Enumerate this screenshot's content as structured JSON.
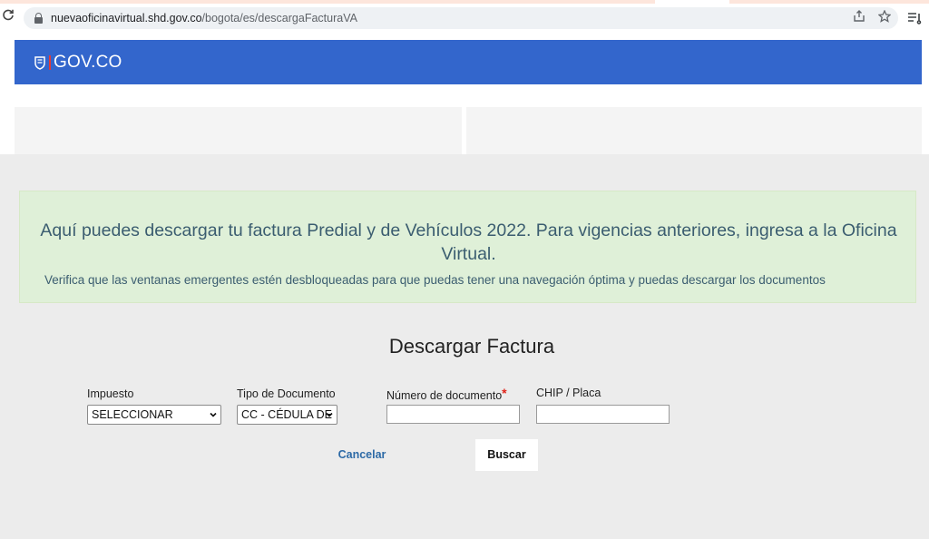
{
  "browser": {
    "url_domain": "nuevaoficinavirtual.shd.gov.co",
    "url_path": "/bogota/es/descargaFacturaVA",
    "icons": [
      "reload-icon",
      "lock-icon",
      "share-icon",
      "star-icon",
      "reading-list-icon"
    ]
  },
  "header": {
    "logo_text": "GOV.CO",
    "color": "#3366cc"
  },
  "alert": {
    "title": "Aquí puedes descargar tu factura Predial y de Vehículos 2022. Para vigencias anteriores, ingresa a la Oficina Virtual.",
    "note": "Verifica que las ventanas emergentes estén desbloqueadas para que puedas tener una navegación óptima y puedas descargar los documentos"
  },
  "form": {
    "title": "Descargar Factura",
    "impuesto_label": "Impuesto",
    "impuesto_value": "SELECCIONAR",
    "tipo_documento_label": "Tipo de Documento",
    "tipo_documento_value": "CC - CÉDULA DE",
    "numero_documento_label": "Número de documento",
    "required_mark": "*",
    "chip_placa_label": "CHIP / Placa",
    "numero_documento_value": "",
    "chip_placa_value": "",
    "cancel_label": "Cancelar",
    "search_label": "Buscar"
  },
  "colors": {
    "alert_bg": "#dff0d8",
    "alert_text": "#3b5d70",
    "cancel_text": "#2d6aa6",
    "required": "#e0231a"
  }
}
